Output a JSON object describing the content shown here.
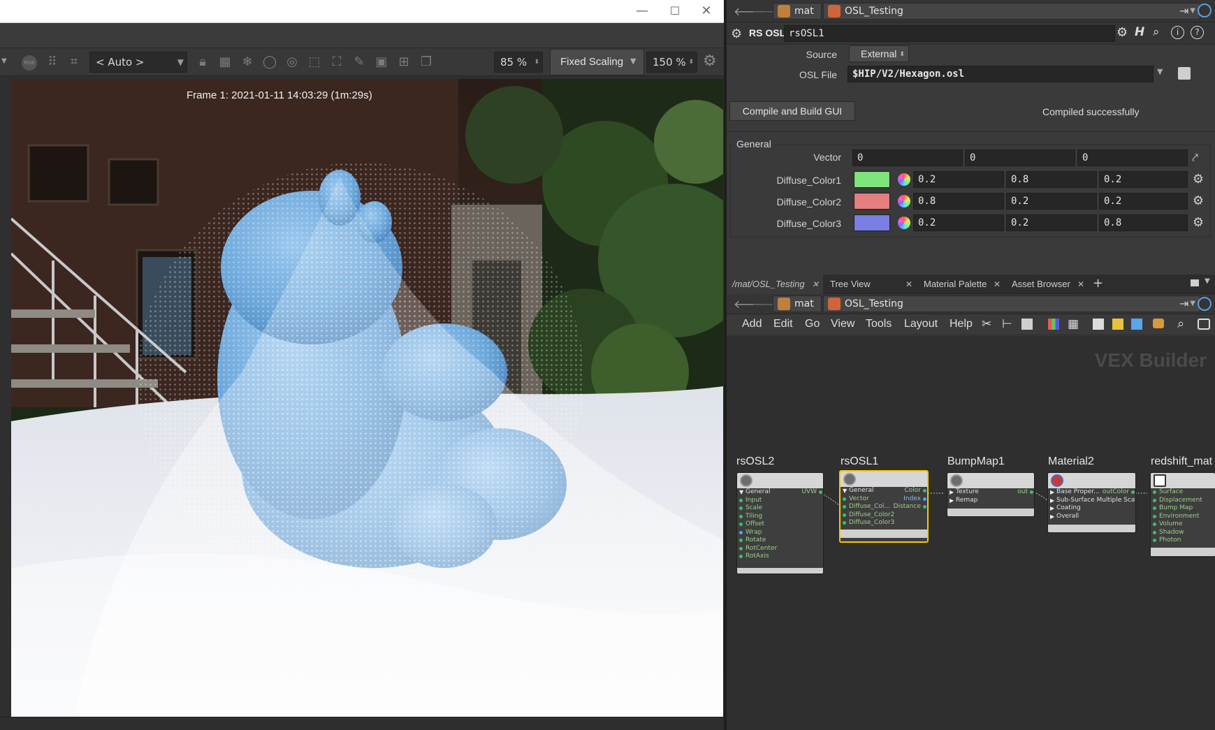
{
  "render_view": {
    "window_controls": [
      "—",
      "☐",
      "✕"
    ],
    "toolbar": {
      "rgb_label": "RGB",
      "display_window": "< Auto >",
      "zoom_value": "85 %",
      "scaling_mode": "Fixed Scaling",
      "scale_value": "150 %"
    },
    "frame_label": "Frame  1:  2021-01-11  14:03:29  (1m:29s)"
  },
  "parm_pane": {
    "path": [
      "mat",
      "OSL_Testing"
    ],
    "node_type": "RS OSL",
    "node_name": "rsOSL1",
    "source_label": "Source",
    "source_value": "External",
    "osl_file_label": "OSL File",
    "osl_file_value": "$HIP/V2/Hexagon.osl",
    "compile_button": "Compile and Build GUI",
    "compile_status": "Compiled successfully",
    "general_label": "General",
    "vector": {
      "label": "Vector",
      "values": [
        "0",
        "0",
        "0"
      ]
    },
    "colors": [
      {
        "label": "Diffuse_Color1",
        "swatch": "#7de37a",
        "values": [
          "0.2",
          "0.8",
          "0.2"
        ]
      },
      {
        "label": "Diffuse_Color2",
        "swatch": "#e47f7d",
        "values": [
          "0.8",
          "0.2",
          "0.2"
        ]
      },
      {
        "label": "Diffuse_Color3",
        "swatch": "#7a7fe3",
        "values": [
          "0.2",
          "0.2",
          "0.8"
        ]
      }
    ]
  },
  "network_pane": {
    "tabs": [
      "/mat/OSL_Testing",
      "Tree View",
      "Material Palette",
      "Asset Browser"
    ],
    "path": [
      "mat",
      "OSL_Testing"
    ],
    "menus": [
      "Add",
      "Edit",
      "Go",
      "View",
      "Tools",
      "Layout",
      "Help"
    ],
    "context_title": "VEX Builder",
    "nodes": [
      {
        "name": "rsOSL2",
        "section": "General",
        "inputs": [
          "Input",
          "Scale",
          "Tiling",
          "Offset",
          "Wrap",
          "Rotate",
          "RotCenter",
          "RotAxis"
        ],
        "outputs": [
          "UVW"
        ]
      },
      {
        "name": "rsOSL1",
        "section": "General",
        "inputs": [
          "Vector",
          "Diffuse_Col...",
          "Diffuse_Color2",
          "Diffuse_Color3"
        ],
        "outputs": [
          "Color",
          "Index",
          "Distance"
        ]
      },
      {
        "name": "BumpMap1",
        "groups": [
          "Texture",
          "Remap"
        ],
        "outputs": [
          "out"
        ]
      },
      {
        "name": "Material2",
        "groups": [
          "Base Proper...",
          "Sub-Surface Multiple Scatteri...",
          "Coating",
          "Overall"
        ],
        "outputs": [
          "outColor"
        ]
      },
      {
        "name": "redshift_mat",
        "inputs": [
          "Surface",
          "Displacement",
          "Bump Map",
          "Environment",
          "Volume",
          "Shadow",
          "Photon"
        ]
      }
    ]
  },
  "colors": {
    "selected_node": "#f5c800",
    "wire_dot": "#3ac06a"
  }
}
